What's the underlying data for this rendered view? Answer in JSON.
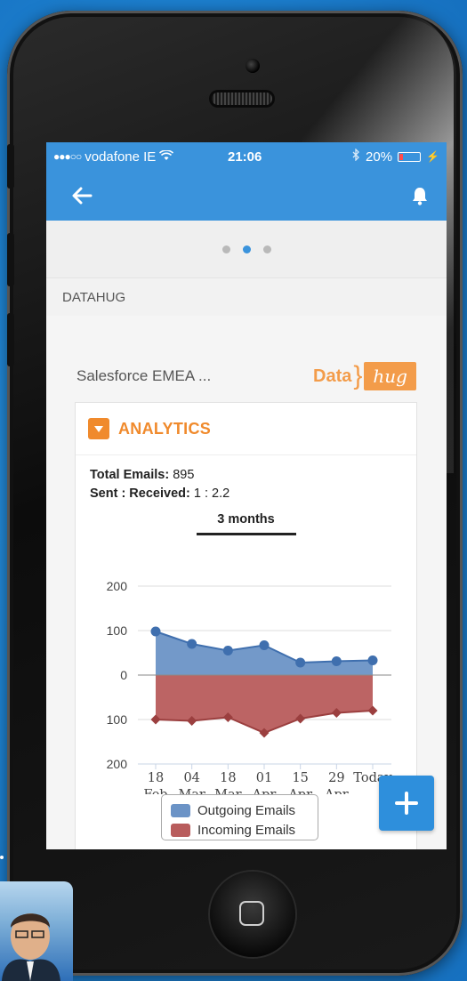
{
  "status_bar": {
    "carrier": "vodafone IE",
    "time": "21:06",
    "battery": "20%",
    "battery_level": 0.2
  },
  "nav": {
    "back_icon": "arrow-left-icon",
    "notifications_icon": "bell-icon"
  },
  "pager": {
    "pages": 3,
    "active_index": 1
  },
  "section_label": "DATAHUG",
  "company": {
    "name": "Salesforce EMEA ...",
    "logo_text_left": "Data",
    "logo_text_right": "hug"
  },
  "analytics": {
    "title": "ANALYTICS",
    "total_emails_label": "Total Emails:",
    "total_emails_value": "895",
    "sent_received_label": "Sent : Received:",
    "sent_received_value": "1 : 2.2",
    "period_tab": "3 months"
  },
  "chart_data": {
    "type": "area",
    "categories": [
      "18 Feb",
      "04 Mar",
      "18 Mar",
      "01 Apr",
      "15 Apr",
      "29 Apr",
      "Today"
    ],
    "category_lines": [
      [
        "18",
        "Feb"
      ],
      [
        "04",
        "Mar"
      ],
      [
        "18",
        "Mar"
      ],
      [
        "01",
        "Apr"
      ],
      [
        "15",
        "Apr"
      ],
      [
        "29",
        "Apr"
      ],
      [
        "Today",
        ""
      ]
    ],
    "y_ticks": [
      200,
      100,
      0,
      -100,
      -200
    ],
    "y_tick_labels": [
      "200",
      "100",
      "0",
      "100",
      "200"
    ],
    "ylim": [
      -200,
      200
    ],
    "series": [
      {
        "name": "Outgoing Emails",
        "values": [
          98,
          70,
          55,
          67,
          28,
          31,
          33
        ],
        "color": "#6b93c6"
      },
      {
        "name": "Incoming Emails",
        "values": [
          -100,
          -103,
          -95,
          -130,
          -98,
          -85,
          -80
        ],
        "color": "#b85c5c"
      }
    ],
    "legend_position": "bottom"
  },
  "fab": {
    "icon": "plus-icon"
  },
  "colors": {
    "brand_blue": "#3a93dc",
    "accent_orange": "#f08a2c",
    "outgoing_line": "#3f6fae",
    "incoming_line": "#9b3f3f"
  }
}
